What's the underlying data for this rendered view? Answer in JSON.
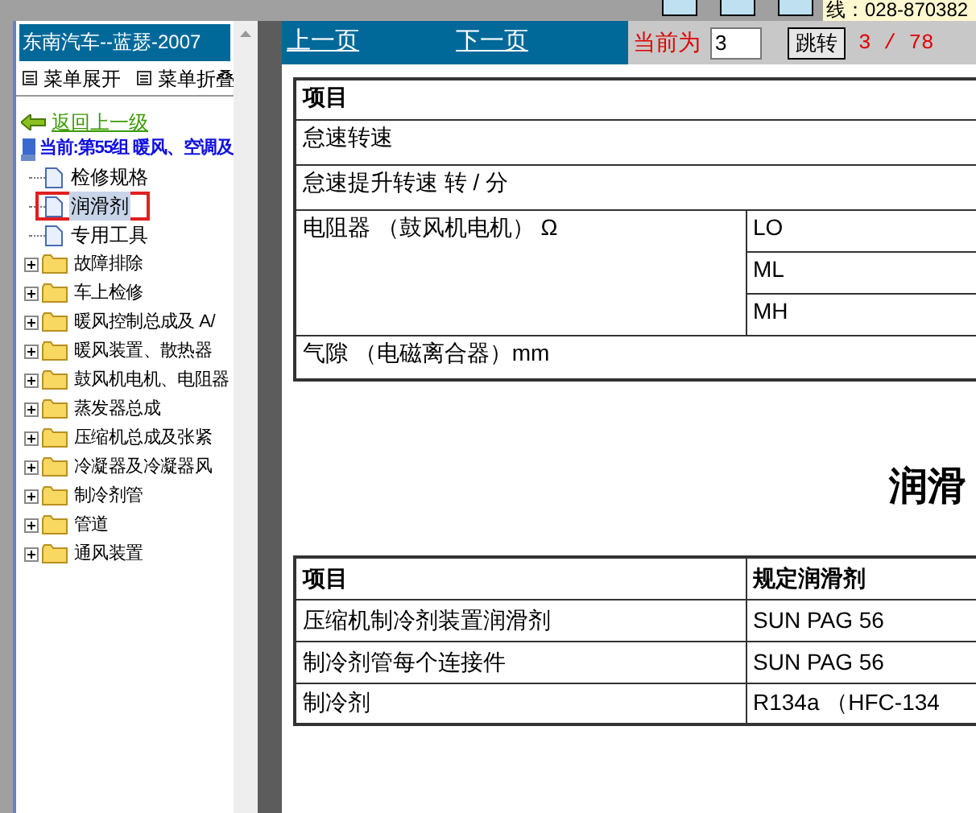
{
  "top_strip": {
    "phone": "线：028-870382"
  },
  "sidebar": {
    "title": "东南汽车--蓝瑟-2007",
    "menu_buttons": [
      "菜单展开",
      "菜单折叠"
    ],
    "back_link": "返回上一级",
    "current": {
      "label": "当前:第55组 暖风、空调及",
      "children": [
        {
          "label": "检修规格",
          "selected": false
        },
        {
          "label": "润滑剂",
          "selected": true
        },
        {
          "label": "专用工具",
          "selected": false
        }
      ]
    },
    "folders": [
      {
        "label": "故障排除",
        "expanded": false
      },
      {
        "label": "车上检修",
        "expanded": false
      },
      {
        "label": "暖风控制总成及 A/",
        "expanded": false
      },
      {
        "label": "暖风装置、散热器",
        "expanded": false
      },
      {
        "label": "鼓风机电机、电阻器",
        "expanded": false
      },
      {
        "label": "蒸发器总成",
        "expanded": false
      },
      {
        "label": "压缩机总成及张紧",
        "expanded": false
      },
      {
        "label": "冷凝器及冷凝器风",
        "expanded": false
      },
      {
        "label": "制冷剂管",
        "expanded": false
      },
      {
        "label": "管道",
        "expanded": false
      },
      {
        "label": "通风装置",
        "expanded": false
      }
    ]
  },
  "nav": {
    "prev": "上一页",
    "next": "下一页",
    "current_label": "当前为",
    "page_value": "3",
    "go_button": "跳转",
    "page_count": "3 / 78"
  },
  "spec_table": {
    "rows": [
      {
        "cells": [
          "项目"
        ],
        "header": true
      },
      {
        "cells": [
          "怠速转速"
        ],
        "header": false
      },
      {
        "cells": [
          "怠速提升转速 转 / 分"
        ],
        "header": false
      },
      {
        "cells": [
          "电阻器 （鼓风机电机） Ω"
        ],
        "sub": [
          "LO",
          "ML",
          "MH"
        ],
        "header": false
      },
      {
        "cells": [
          "气隙 （电磁离合器）mm"
        ],
        "header": false
      }
    ]
  },
  "section_title": "润滑",
  "lube_table": {
    "columns": [
      "项目",
      "规定润滑剂"
    ],
    "rows": [
      [
        "压缩机制冷剂装置润滑剂",
        "SUN PAG 56"
      ],
      [
        "制冷剂管每个连接件",
        "SUN PAG 56"
      ],
      [
        "制冷剂",
        "R134a （HFC-134"
      ]
    ]
  }
}
